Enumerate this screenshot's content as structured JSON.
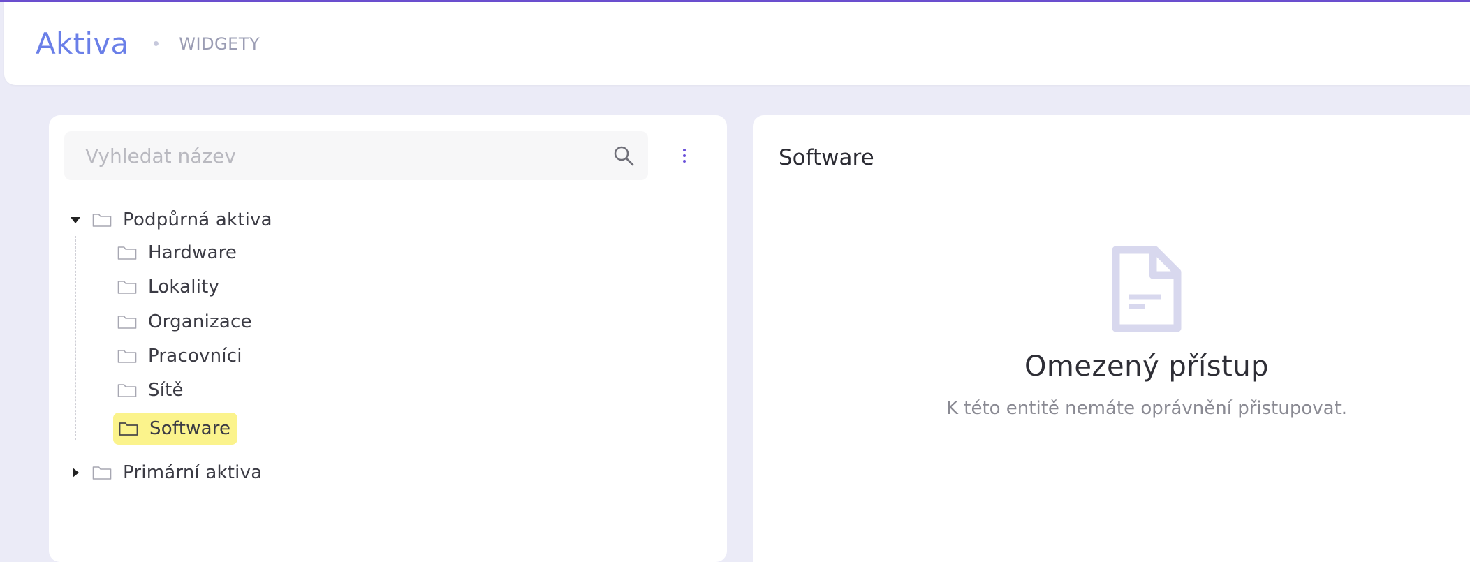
{
  "header": {
    "title": "Aktiva",
    "subtitle": "WIDGETY"
  },
  "search": {
    "placeholder": "Vyhledat název",
    "value": ""
  },
  "tree": {
    "root_supporting": {
      "label": "Podpůrná aktiva",
      "expanded": true,
      "children": [
        {
          "label": "Hardware"
        },
        {
          "label": "Lokality"
        },
        {
          "label": "Organizace"
        },
        {
          "label": "Pracovníci"
        },
        {
          "label": "Sítě"
        },
        {
          "label": "Software",
          "selected": true
        }
      ]
    },
    "root_primary": {
      "label": "Primární aktiva",
      "expanded": false
    }
  },
  "detail": {
    "title": "Software",
    "empty_title": "Omezený přístup",
    "empty_text": "K této entitě nemáte oprávnění přistupovat."
  },
  "colors": {
    "accent": "#6b4fcf",
    "title_blue": "#6a7fe8",
    "selected_bg": "#fbf38c",
    "page_bg": "#ebebf7"
  },
  "icons": {
    "search": "search-icon",
    "folder": "folder-icon",
    "document": "document-icon",
    "menu": "kebab-menu-icon",
    "expand": "triangle-down-icon",
    "collapse": "triangle-right-icon"
  }
}
